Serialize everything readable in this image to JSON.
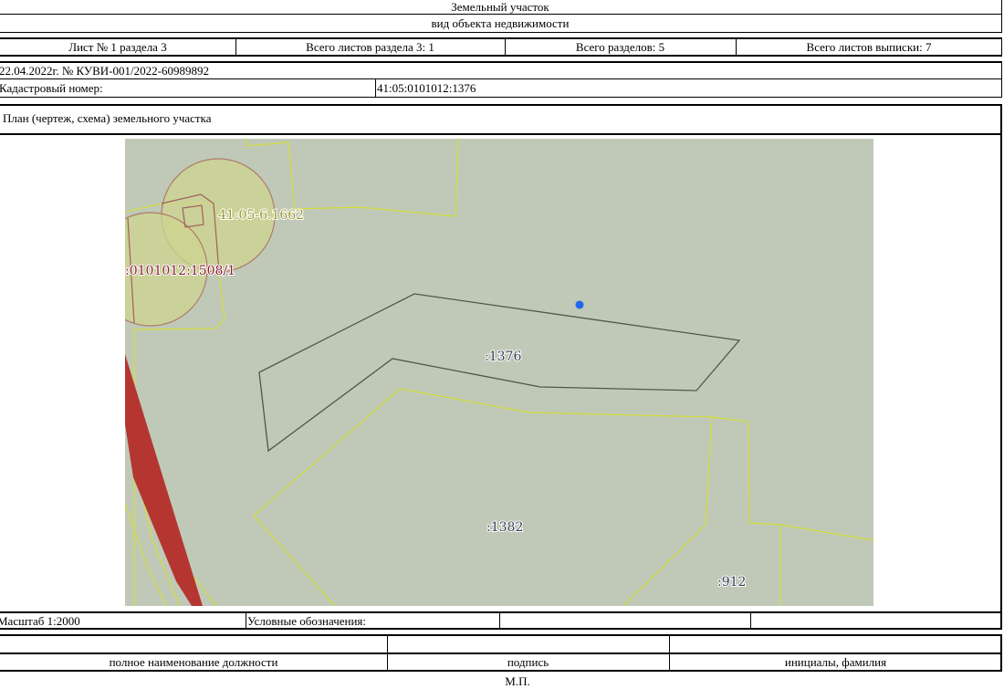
{
  "header": {
    "object_title": "Земельный участок",
    "object_type_caption": "вид объекта недвижимости"
  },
  "sheet_info": {
    "sheet": "Лист № 1 раздела 3",
    "section_sheets": "Всего листов раздела 3: 1",
    "total_sections": "Всего разделов: 5",
    "total_sheets": "Всего листов выписки: 7"
  },
  "doc_ref": "22.04.2022г. № КУВИ-001/2022-60989892",
  "cadastral": {
    "label": "Кадастровый номер:",
    "value": "41:05:0101012:1376"
  },
  "plan_title": "План (чертеж, схема) земельного участка",
  "map": {
    "labels": {
      "zone": "41:05-6.1662",
      "neighbor": ":0101012:1508/1",
      "main_parcel": ":1376",
      "parcel_1382": ":1382",
      "parcel_912": ":912"
    },
    "colors": {
      "background": "#c0c9b7",
      "parcel_border": "#4a5a48",
      "neighbor_border": "#d4de3a",
      "zone_fill": "#cdd48f",
      "zone_border": "#b07a6a",
      "road": "#b53630",
      "marker": "#2266ee",
      "zone_label": "#9a9a30",
      "neighbor_label": "#8a1f3a",
      "parcel_label": "#3a3a55"
    }
  },
  "footer": {
    "scale": "Масштаб 1:2000",
    "legend": "Условные обозначения:",
    "position_caption": "полное наименование должности",
    "signature_caption": "подпись",
    "name_caption": "инициалы, фамилия",
    "stamp": "М.П."
  }
}
